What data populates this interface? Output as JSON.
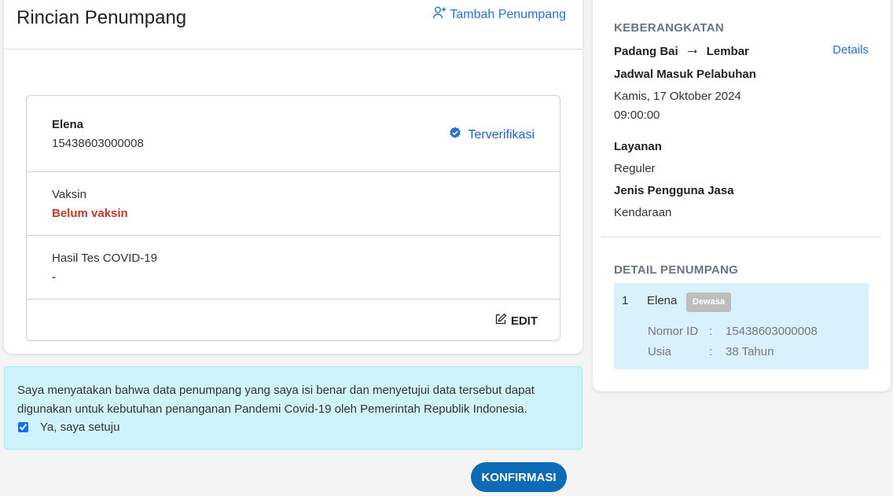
{
  "left": {
    "title": "Rincian Penumpang",
    "add_passenger": "Tambah Penumpang",
    "passenger": {
      "name": "Elena",
      "id_number": "15438603000008",
      "verified_label": "Terverifikasi",
      "vaccine_label": "Vaksin",
      "vaccine_value": "Belum vaksin",
      "covid_label": "Hasil Tes COVID-19",
      "covid_value": "-",
      "edit_label": "EDIT"
    }
  },
  "consent": {
    "text": "Saya menyatakan bahwa data penumpang yang saya isi benar dan menyetujui data tersebut dapat digunakan untuk kebutuhan penanganan Pandemi Covid-19 oleh Pemerintah Republik Indonesia.",
    "checkbox_label": "Ya, saya setuju",
    "checked": true
  },
  "confirm_label": "KONFIRMASI",
  "right": {
    "departure_heading": "KEBERANGKATAN",
    "origin": "Padang Bai",
    "arrow": "→",
    "destination": "Lembar",
    "details_link": "Details",
    "schedule_label": "Jadwal Masuk Pelabuhan",
    "schedule_date": "Kamis, 17 Oktober 2024",
    "schedule_time": "09:00:00",
    "service_label": "Layanan",
    "service_value": "Reguler",
    "user_type_label": "Jenis Pengguna Jasa",
    "user_type_value": "Kendaraan",
    "passenger_heading": "DETAIL PENUMPANG",
    "passenger_summary": {
      "number": "1",
      "name": "Elena",
      "badge": "Dewasa",
      "id_label": "Nomor ID",
      "id_value": "15438603000008",
      "age_label": "Usia",
      "age_value": "38 Tahun",
      "colon": ":"
    }
  },
  "colors": {
    "primary_button": "#0d6ab5",
    "link": "#2a6fd6",
    "danger": "#c0392b",
    "consent_bg": "#cff3fa",
    "summary_bg": "#d8f1fb"
  }
}
